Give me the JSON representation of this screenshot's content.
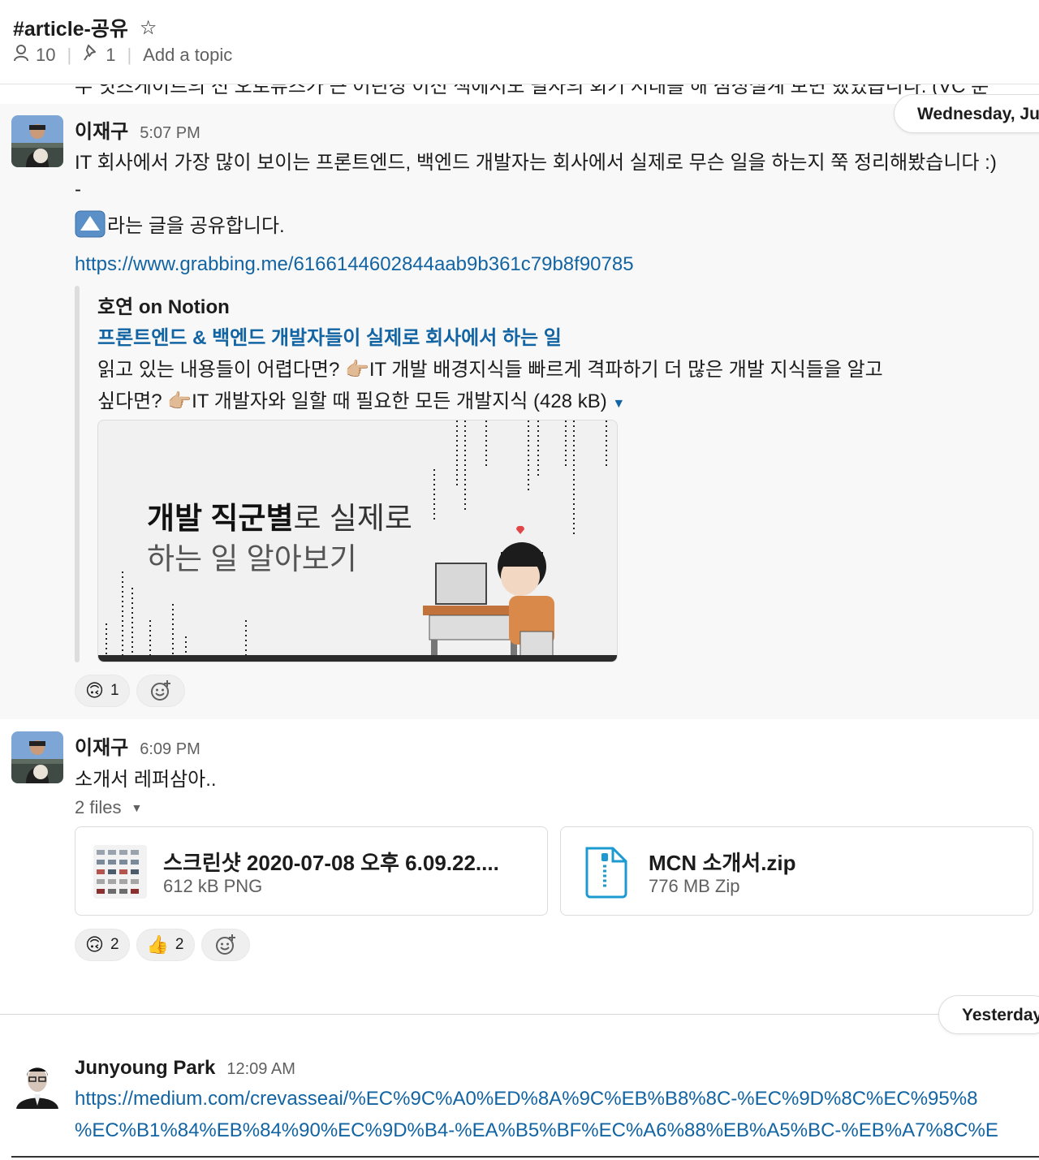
{
  "header": {
    "channel": "#article-공유",
    "members": "10",
    "pins": "1",
    "topic": "Add a topic"
  },
  "cut_text": "두 잇츠게이트의 전 오로퓨즈가 큰 어린성 이전 책에서도 필자의 회기 저대를 해 점성설계 보면 했었습니다. (VC 분",
  "date_pills": {
    "first": "Wednesday, Ju",
    "second": "Yesterday"
  },
  "msg1": {
    "sender": "이재구",
    "time": "5:07 PM",
    "line1": "IT 회사에서 가장 많이 보이는 프론트엔드, 백엔드 개발자는 회사에서 실제로 무슨 일을 하는지 쭉 정리해봤습니다 :)",
    "line2": "-",
    "line3": "라는 글을 공유합니다.",
    "link": "https://www.grabbing.me/6166144602844aab9b361c79b8f90785",
    "unfurl": {
      "site": "호연 on Notion",
      "title": "프론트엔드 & 백엔드 개발자들이 실제로 회사에서 하는 일",
      "desc1": "읽고 있는 내용들이 어렵다면? 👉🏼IT 개발 배경지식들 빠르게 격파하기 더 많은 개발 지식들을 알고",
      "desc2": "싶다면? 👉🏼IT 개발자와 일할 때 필요한 모든 개발지식 (428 kB)",
      "preview_bold": "개발 직군별",
      "preview_rest": "로 실제로",
      "preview_line2": "하는 일 알아보기"
    },
    "reactions": [
      {
        "emoji": "🙃",
        "count": "1"
      }
    ]
  },
  "msg2": {
    "sender": "이재구",
    "time": "6:09 PM",
    "text": "소개서 레퍼삼아..",
    "files_label": "2 files",
    "files": [
      {
        "name": "스크린샷 2020-07-08 오후 6.09.22....",
        "meta": "612 kB PNG"
      },
      {
        "name": "MCN 소개서.zip",
        "meta": "776 MB Zip"
      }
    ],
    "reactions": [
      {
        "emoji": "🙃",
        "count": "2"
      },
      {
        "emoji": "👍",
        "count": "2"
      }
    ]
  },
  "msg3": {
    "sender": "Junyoung Park",
    "time": "12:09 AM",
    "link1": "https://medium.com/crevasseai/%EC%9C%A0%ED%8A%9C%EB%B8%8C-%EC%9D%8C%EC%95%8",
    "link2": "%EC%B1%84%EB%84%90%EC%9D%B4-%EA%B5%BF%EC%A6%88%EB%A5%BC-%EB%A7%8C%E"
  },
  "colors": {
    "link": "#1264a3",
    "highlight_bg": "#f8f8f8",
    "muted": "#616061"
  }
}
